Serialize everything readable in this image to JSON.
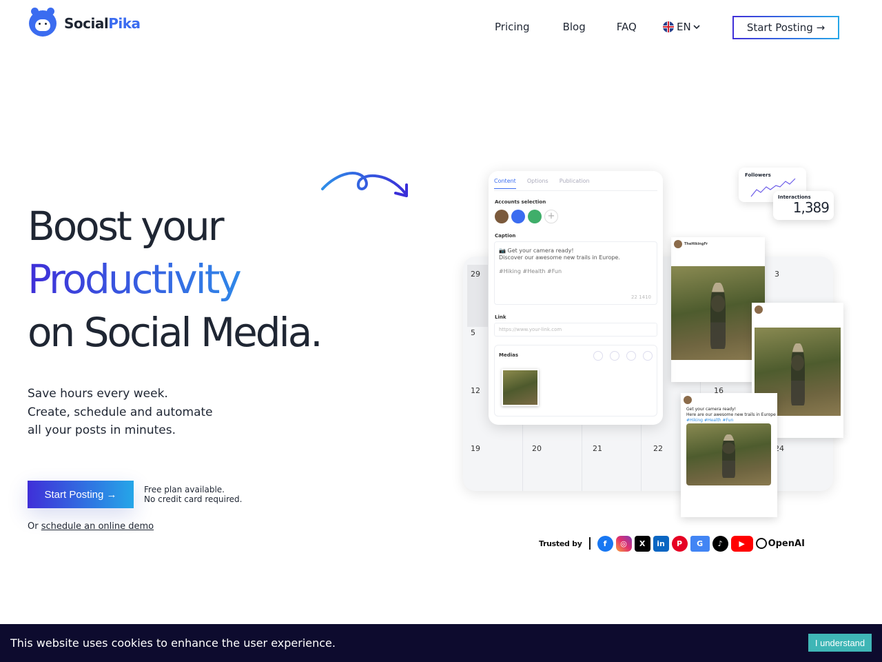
{
  "brand": {
    "name_part1": "Social",
    "name_part2": "Pika"
  },
  "nav": {
    "links": [
      "Pricing",
      "Blog",
      "FAQ"
    ],
    "language": "EN",
    "cta": "Start Posting →"
  },
  "hero": {
    "title_line1": "Boost your",
    "title_line2": "Productivity",
    "title_line3": "on Social Media.",
    "sub_line1": "Save hours every week.",
    "sub_line2": "Create, schedule and automate",
    "sub_line3": "all your posts in minutes.",
    "cta": "Start Posting →",
    "note_line1": "Free plan available.",
    "note_line2": "No credit card required.",
    "demo_prefix": "Or ",
    "demo_link": "schedule an online demo"
  },
  "mockup": {
    "tabs": [
      "Content",
      "Options",
      "Publication"
    ],
    "accounts_label": "Accounts selection",
    "caption_label": "Caption",
    "caption_line1": "📷 Get your camera ready!",
    "caption_line2": "Discover our awesome new trails in Europe.",
    "caption_tags": "#Hiking #Health #Fun",
    "caption_count": "22  1410",
    "link_label": "Link",
    "link_placeholder": "https://www.your-link.com",
    "medias_label": "Medias",
    "followers_label": "Followers",
    "interactions_label": "Interactions",
    "interactions_value": "1,389",
    "calendar_days": [
      "29",
      "3",
      "5",
      "12",
      "16",
      "19",
      "20",
      "21",
      "22",
      "24"
    ],
    "post_tweet_line1": "Get your camera ready!",
    "post_tweet_line2": "Here are our awesome new trails in Europe",
    "post_tweet_tags": "#Hiking #Health #Fun",
    "post_author": "TheHikingFr"
  },
  "trusted": {
    "label": "Trusted by",
    "brands": [
      "facebook-icon",
      "instagram-icon",
      "x-icon",
      "linkedin-icon",
      "pinterest-icon",
      "google-business-icon",
      "tiktok-icon",
      "youtube-icon"
    ],
    "openai": "OpenAI"
  },
  "cookie": {
    "text": "This website uses cookies to enhance the user experience.",
    "button": "I understand"
  }
}
